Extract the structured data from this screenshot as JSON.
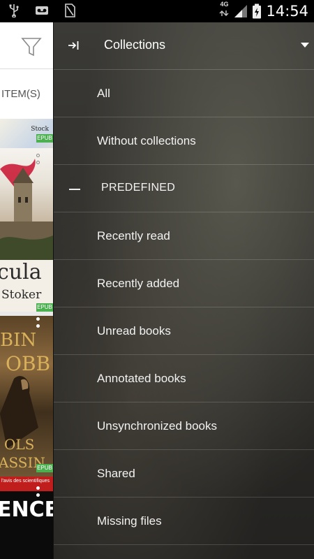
{
  "status_bar": {
    "time": "14:54",
    "network": "4G",
    "left_icons": [
      "usb-icon",
      "voicemail-icon",
      "no-sim-icon"
    ],
    "right_icons": [
      "signal-icon",
      "battery-charging-icon"
    ]
  },
  "library": {
    "count_label": "ITEM(S)",
    "books": [
      {
        "title_fragment": "Stock",
        "badge": "EPUB"
      },
      {
        "title_fragment": "cula",
        "author_fragment": "Stoker",
        "badge": "EPUB"
      },
      {
        "title_fragment": "BIN",
        "title_fragment_2": "OBB",
        "subtitle_fragment": "OLS",
        "subtitle_fragment_2": "ASSIN",
        "badge": "EPUB"
      },
      {
        "tagline_fragment": "l'avis des scientifiques",
        "title_fragment": "ENCE"
      }
    ]
  },
  "drawer": {
    "header_title": "Collections",
    "items": [
      {
        "label": "All"
      },
      {
        "label": "Without collections"
      }
    ],
    "section": {
      "label": "PREDEFINED"
    },
    "predefined_items": [
      {
        "label": "Recently read"
      },
      {
        "label": "Recently added"
      },
      {
        "label": "Unread books"
      },
      {
        "label": "Annotated books"
      },
      {
        "label": "Unsynchronized books"
      },
      {
        "label": "Shared"
      },
      {
        "label": "Missing files"
      }
    ]
  },
  "colors": {
    "accent_pink": "#e8285a",
    "drawer_background": "#2c2b28",
    "epub_badge": "#4caf50"
  }
}
